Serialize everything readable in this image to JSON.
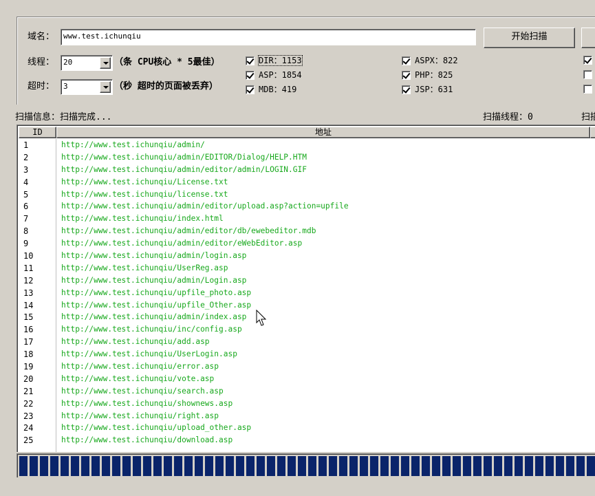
{
  "config": {
    "domain_label": "域名：",
    "domain_value": "www.test.ichunqiu",
    "start_button": "开始扫描",
    "threads_label": "线程：",
    "threads_value": "20",
    "threads_hint": "（条 CPU核心 * 5最佳）",
    "timeout_label": "超时：",
    "timeout_value": "3",
    "timeout_hint": "（秒 超时的页面被丢弃）",
    "checkboxes": [
      {
        "label": "DIR：1153",
        "checked": true
      },
      {
        "label": "ASP：1854",
        "checked": true
      },
      {
        "label": "MDB：419",
        "checked": true
      },
      {
        "label": "ASPX：822",
        "checked": true
      },
      {
        "label": "PHP：825",
        "checked": true
      },
      {
        "label": "JSP：631",
        "checked": true
      },
      {
        "label": "",
        "checked": true
      },
      {
        "label": "",
        "checked": false
      },
      {
        "label": "",
        "checked": false
      }
    ]
  },
  "status": {
    "info_label": "扫描信息：扫描完成...",
    "threads_label": "扫描线程：0",
    "cut_label": "扫描"
  },
  "table": {
    "columns": [
      "ID",
      "地址"
    ],
    "rows": [
      {
        "id": "1",
        "url": "http://www.test.ichunqiu/admin/"
      },
      {
        "id": "2",
        "url": "http://www.test.ichunqiu/admin/EDITOR/Dialog/HELP.HTM"
      },
      {
        "id": "3",
        "url": "http://www.test.ichunqiu/admin/editor/admin/LOGIN.GIF"
      },
      {
        "id": "4",
        "url": "http://www.test.ichunqiu/License.txt"
      },
      {
        "id": "5",
        "url": "http://www.test.ichunqiu/license.txt"
      },
      {
        "id": "6",
        "url": "http://www.test.ichunqiu/admin/editor/upload.asp?action=upfile"
      },
      {
        "id": "7",
        "url": "http://www.test.ichunqiu/index.html"
      },
      {
        "id": "8",
        "url": "http://www.test.ichunqiu/admin/editor/db/ewebeditor.mdb"
      },
      {
        "id": "9",
        "url": "http://www.test.ichunqiu/admin/editor/eWebEditor.asp"
      },
      {
        "id": "10",
        "url": "http://www.test.ichunqiu/admin/login.asp"
      },
      {
        "id": "11",
        "url": "http://www.test.ichunqiu/UserReg.asp"
      },
      {
        "id": "12",
        "url": "http://www.test.ichunqiu/admin/Login.asp"
      },
      {
        "id": "13",
        "url": "http://www.test.ichunqiu/upfile_photo.asp"
      },
      {
        "id": "14",
        "url": "http://www.test.ichunqiu/upfile_Other.asp"
      },
      {
        "id": "15",
        "url": "http://www.test.ichunqiu/admin/index.asp"
      },
      {
        "id": "16",
        "url": "http://www.test.ichunqiu/inc/config.asp"
      },
      {
        "id": "17",
        "url": "http://www.test.ichunqiu/add.asp"
      },
      {
        "id": "18",
        "url": "http://www.test.ichunqiu/UserLogin.asp"
      },
      {
        "id": "19",
        "url": "http://www.test.ichunqiu/error.asp"
      },
      {
        "id": "20",
        "url": "http://www.test.ichunqiu/vote.asp"
      },
      {
        "id": "21",
        "url": "http://www.test.ichunqiu/search.asp"
      },
      {
        "id": "22",
        "url": "http://www.test.ichunqiu/shownews.asp"
      },
      {
        "id": "23",
        "url": "http://www.test.ichunqiu/right.asp"
      },
      {
        "id": "24",
        "url": "http://www.test.ichunqiu/upload_other.asp"
      },
      {
        "id": "25",
        "url": "http://www.test.ichunqiu/download.asp"
      }
    ]
  },
  "progress": {
    "value": 1.0
  },
  "colors": {
    "url_text": "#17a81c",
    "progress_block": "#0a246a",
    "window_bg": "#d4d0c8"
  }
}
